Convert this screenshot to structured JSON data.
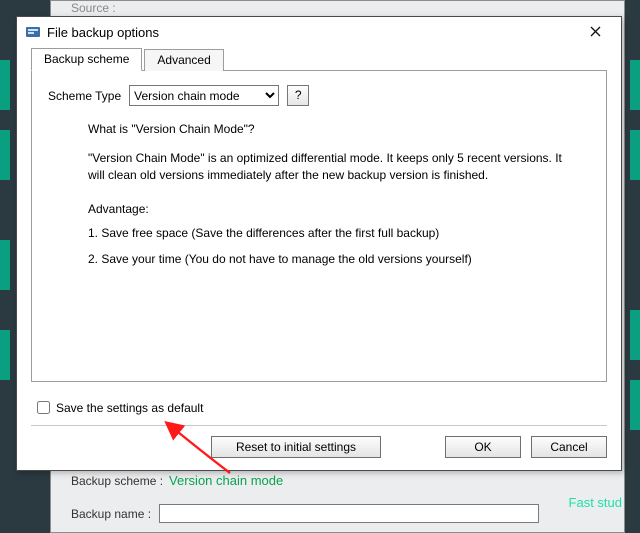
{
  "background": {
    "source_label": "Source :",
    "scheme_label": "Backup scheme :",
    "scheme_value": "Version chain mode",
    "name_label": "Backup name :",
    "fast_text": "Fast stud"
  },
  "dialog": {
    "title": "File backup options",
    "tabs": {
      "scheme": "Backup scheme",
      "advanced": "Advanced"
    },
    "scheme_type_label": "Scheme Type",
    "scheme_type_value": "Version chain mode",
    "help_label": "?",
    "what_is": "What is \"Version Chain Mode\"?",
    "description": "\"Version Chain Mode\" is an optimized differential mode. It keeps only 5 recent versions. It will clean old versions immediately after the new backup version is finished.",
    "advantage_title": "Advantage:",
    "advantage_1": "1. Save free space (Save the differences after the first full backup)",
    "advantage_2": "2. Save your time (You do not have to manage the old versions yourself)",
    "save_default_label": "Save the settings as default",
    "buttons": {
      "reset": "Reset to initial settings",
      "ok": "OK",
      "cancel": "Cancel"
    }
  }
}
